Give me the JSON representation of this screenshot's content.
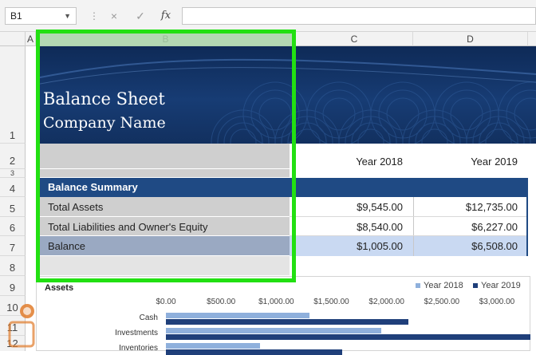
{
  "formula_bar": {
    "cell_ref": "B1",
    "cancel_icon": "×",
    "enter_icon": "✓",
    "fx_label": "fx",
    "content": ""
  },
  "columns": [
    "A",
    "B",
    "C",
    "D"
  ],
  "rows": [
    "1",
    "2",
    "3",
    "4",
    "5",
    "6",
    "7",
    "8",
    "9",
    "10",
    "11",
    "12"
  ],
  "banner": {
    "title": "Balance Sheet",
    "subtitle": "Company Name"
  },
  "year_headers": [
    "Year 2018",
    "Year 2019"
  ],
  "summary_title": "Balance Summary",
  "table_rows": [
    {
      "label": "Total Assets",
      "y2018": "$9,545.00",
      "y2019": "$12,735.00"
    },
    {
      "label": "Total Liabilities and Owner's Equity",
      "y2018": "$8,540.00",
      "y2019": "$6,227.00"
    },
    {
      "label": "Balance",
      "y2018": "$1,005.00",
      "y2019": "$6,508.00"
    }
  ],
  "colors": {
    "selection": "#22e012",
    "header_blue": "#1f4a84",
    "series_2018": "#8fb0dc",
    "series_2019": "#1f3f7a"
  },
  "chart_data": {
    "type": "bar",
    "orientation": "horizontal",
    "title": "Assets",
    "categories": [
      "Cash",
      "Investments",
      "Inventories"
    ],
    "x_ticks": [
      "$0.00",
      "$500.00",
      "$1,000.00",
      "$1,500.00",
      "$2,000.00",
      "$2,500.00",
      "$3,000.00"
    ],
    "xlim": [
      0,
      3000
    ],
    "series": [
      {
        "name": "Year 2018",
        "values": [
          1300,
          1950,
          850
        ]
      },
      {
        "name": "Year 2019",
        "values": [
          2200,
          3300,
          1600
        ]
      }
    ],
    "legend_position": "top-right"
  },
  "watermark": {
    "text": "پرتقال"
  }
}
